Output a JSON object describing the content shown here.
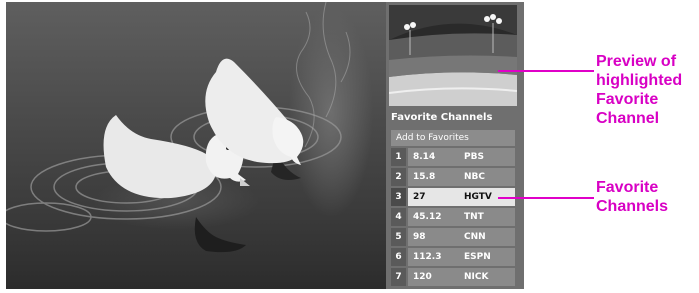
{
  "guide": {
    "title": "Favorite Channels",
    "add_label": "Add to Favorites",
    "channels": [
      {
        "index": "1",
        "number": "8.14",
        "name": "PBS",
        "selected": false
      },
      {
        "index": "2",
        "number": "15.8",
        "name": "NBC",
        "selected": false
      },
      {
        "index": "3",
        "number": "27",
        "name": "HGTV",
        "selected": true
      },
      {
        "index": "4",
        "number": "45.12",
        "name": "TNT",
        "selected": false
      },
      {
        "index": "5",
        "number": "98",
        "name": "CNN",
        "selected": false
      },
      {
        "index": "6",
        "number": "112.3",
        "name": "ESPN",
        "selected": false
      },
      {
        "index": "7",
        "number": "120",
        "name": "NICK",
        "selected": false
      }
    ]
  },
  "callouts": {
    "preview": [
      "Preview of",
      "highlighted",
      "Favorite",
      "Channel"
    ],
    "channels": [
      "Favorite",
      "Channels"
    ],
    "color": "#d800c4"
  },
  "colors": {
    "panel_bg": "#6f6f6f",
    "row_bg": "#8a8a8a",
    "row_selected_bg": "#e6e6e6"
  }
}
